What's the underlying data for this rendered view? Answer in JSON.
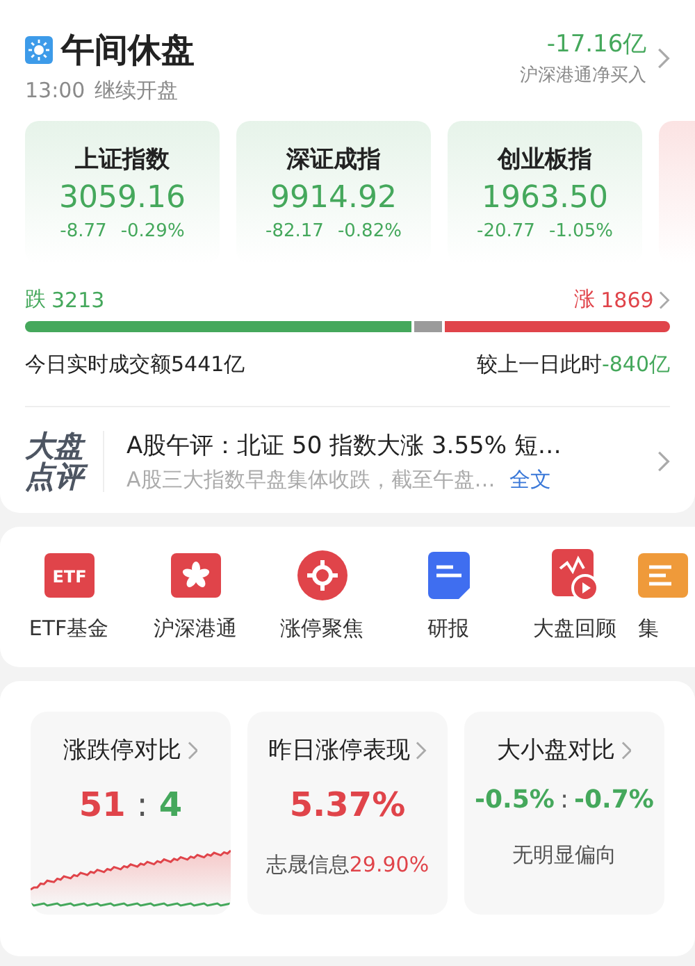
{
  "header": {
    "title": "午间休盘",
    "time": "13:00",
    "subtitle": "继续开盘"
  },
  "net_flow": {
    "value": "-17.16亿",
    "label": "沪深港通净买入"
  },
  "indices": [
    {
      "name": "上证指数",
      "value": "3059.16",
      "change": "-8.77",
      "percent": "-0.29%",
      "color": "#45a85c"
    },
    {
      "name": "深证成指",
      "value": "9914.92",
      "change": "-82.17",
      "percent": "-0.82%",
      "color": "#45a85c"
    },
    {
      "name": "创业板指",
      "value": "1963.50",
      "change": "-20.77",
      "percent": "-1.05%",
      "color": "#45a85c"
    }
  ],
  "breadth": {
    "down_label": "跌",
    "down_count": "3213",
    "up_label": "涨",
    "up_count": "1869"
  },
  "turnover": {
    "label": "今日实时成交额5441亿",
    "compare_label": "较上一日此时",
    "compare_value": "-840亿"
  },
  "news": {
    "badge_top": "大盘",
    "badge_bottom": "点评",
    "headline": "A股午评：北证 50 指数大涨 3.55% 短…",
    "summary": "A股三大指数早盘集体收跌，截至午盘…",
    "link": "全文"
  },
  "shortcuts": [
    {
      "label": "ETF基金",
      "kind": "etf",
      "icon_text": "ETF"
    },
    {
      "label": "沪深港通",
      "kind": "flower"
    },
    {
      "label": "涨停聚焦",
      "kind": "target"
    },
    {
      "label": "研报",
      "kind": "doc"
    },
    {
      "label": "大盘回顾",
      "kind": "replay"
    },
    {
      "label": "集",
      "kind": "auction"
    }
  ],
  "stats": [
    {
      "kind": "ratio-chart",
      "title": "涨跌停对比",
      "separator": ":",
      "values": [
        {
          "text": "51",
          "color": "#e0444a"
        },
        {
          "text": "4",
          "color": "#45a85c"
        }
      ]
    },
    {
      "kind": "value-note",
      "title": "昨日涨停表现",
      "value": "5.37%",
      "color": "#e0444a",
      "note_label": "志晟信息",
      "note_value": "29.90%"
    },
    {
      "kind": "ratio-note",
      "title": "大小盘对比",
      "separator": ":",
      "values": [
        {
          "text": "-0.5%",
          "color": "#45a85c"
        },
        {
          "text": "-0.7%",
          "color": "#45a85c"
        }
      ],
      "note_label": "无明显偏向"
    }
  ]
}
